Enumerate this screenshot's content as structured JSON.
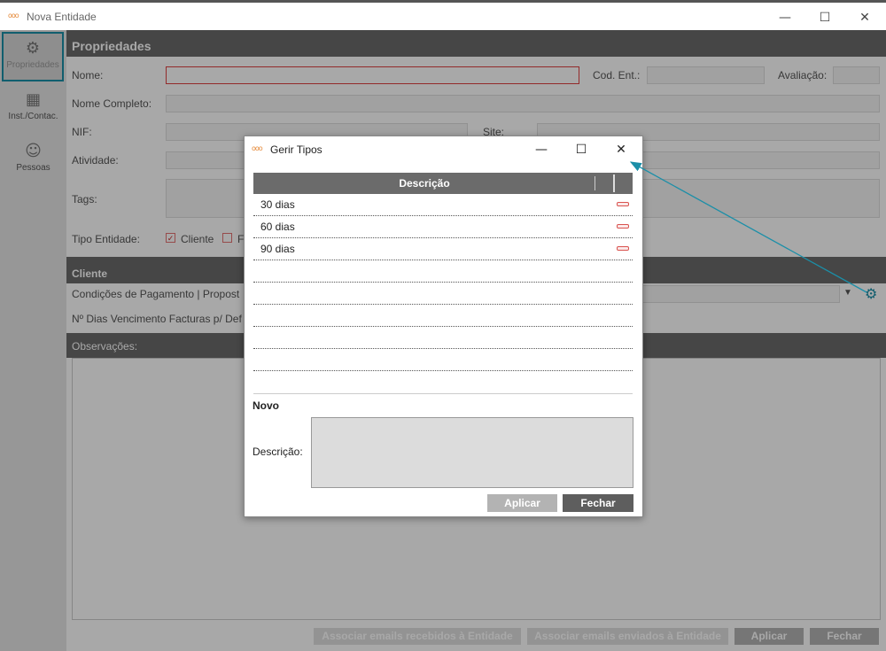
{
  "window": {
    "title": "Nova Entidade",
    "logo": "ooo"
  },
  "sidebar": {
    "items": [
      {
        "label": "Propriedades",
        "icon": "⚙"
      },
      {
        "label": "Inst./Contac.",
        "icon": "▦"
      },
      {
        "label": "Pessoas",
        "icon": "☺"
      }
    ]
  },
  "form": {
    "section_title": "Propriedades",
    "nome_label": "Nome:",
    "cod_ent_label": "Cod. Ent.:",
    "avaliacao_label": "Avaliação:",
    "nome_completo_label": "Nome Completo:",
    "nif_label": "NIF:",
    "site_label": "Site:",
    "atividade_label": "Atividade:",
    "tags_label": "Tags:",
    "tipo_entidade_label": "Tipo Entidade:",
    "tipo_cliente_label": "Cliente",
    "tipo_f_label": "F",
    "cliente_title": "Cliente",
    "condicoes_label": "Condições de Pagamento | Propost",
    "dias_vencimento_label": "Nº Dias Vencimento Facturas p/ Def",
    "observacoes_label": "Observações:",
    "dropdown_arrow": "▼",
    "gear": "⚙"
  },
  "bottom": {
    "assoc_recebidos": "Associar emails recebidos à Entidade",
    "assoc_enviados": "Associar emails enviados à Entidade",
    "aplicar": "Aplicar",
    "fechar": "Fechar"
  },
  "dialog": {
    "title": "Gerir Tipos",
    "logo": "ooo",
    "column_header": "Descrição",
    "rows": [
      "30 dias",
      "60 dias",
      "90 dias",
      "",
      "",
      "",
      "",
      "",
      ""
    ],
    "novo_title": "Novo",
    "descricao_label": "Descrição:",
    "descricao_value": "",
    "aplicar": "Aplicar",
    "fechar": "Fechar"
  },
  "colors": {
    "accent": "#1b8fa8",
    "invalid_border": "#e04040",
    "header_bg": "#6b6b6b"
  }
}
